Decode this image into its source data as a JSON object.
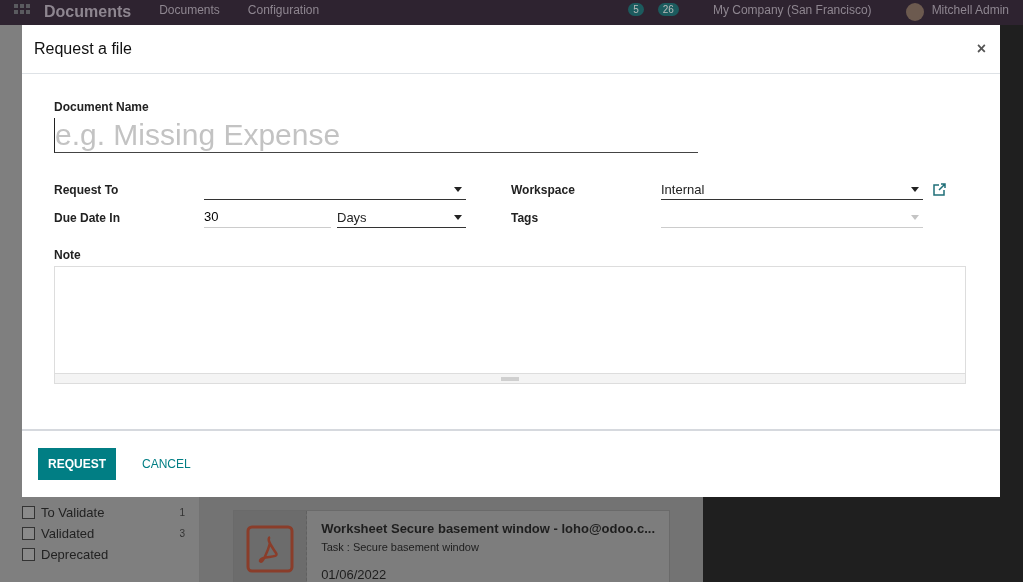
{
  "top_bar": {
    "app_name": "Documents",
    "menu": [
      "Documents",
      "Configuration"
    ],
    "badges": [
      "5",
      "26"
    ],
    "company": "My Company (San Francisco)",
    "user": "Mitchell Admin"
  },
  "sidebar": {
    "filters": [
      {
        "label": "To Validate",
        "count": "1",
        "checked": false
      },
      {
        "label": "Validated",
        "count": "3",
        "checked": false
      },
      {
        "label": "Deprecated",
        "checked": false
      }
    ]
  },
  "card": {
    "title": "Worksheet Secure basement window - loho@odoo.c...",
    "subtitle": "Task : Secure basement window",
    "date": "01/06/2022"
  },
  "dialog": {
    "title": "Request a file",
    "close": "×",
    "document_name": {
      "label": "Document Name",
      "placeholder": "e.g. Missing Expense"
    },
    "left_fields": [
      {
        "label": "Request To",
        "kind": "select"
      },
      {
        "label": "Due Date In",
        "kind": "duration",
        "value": "30",
        "unit": "Days"
      }
    ],
    "right_fields": [
      {
        "label": "Workspace",
        "kind": "select",
        "value": "Internal",
        "external_link": true
      },
      {
        "label": "Tags",
        "kind": "tags"
      }
    ],
    "note": {
      "label": "Note"
    },
    "buttons": [
      {
        "label": "REQUEST",
        "primary": true
      },
      {
        "label": "CANCEL",
        "primary": false
      }
    ]
  }
}
